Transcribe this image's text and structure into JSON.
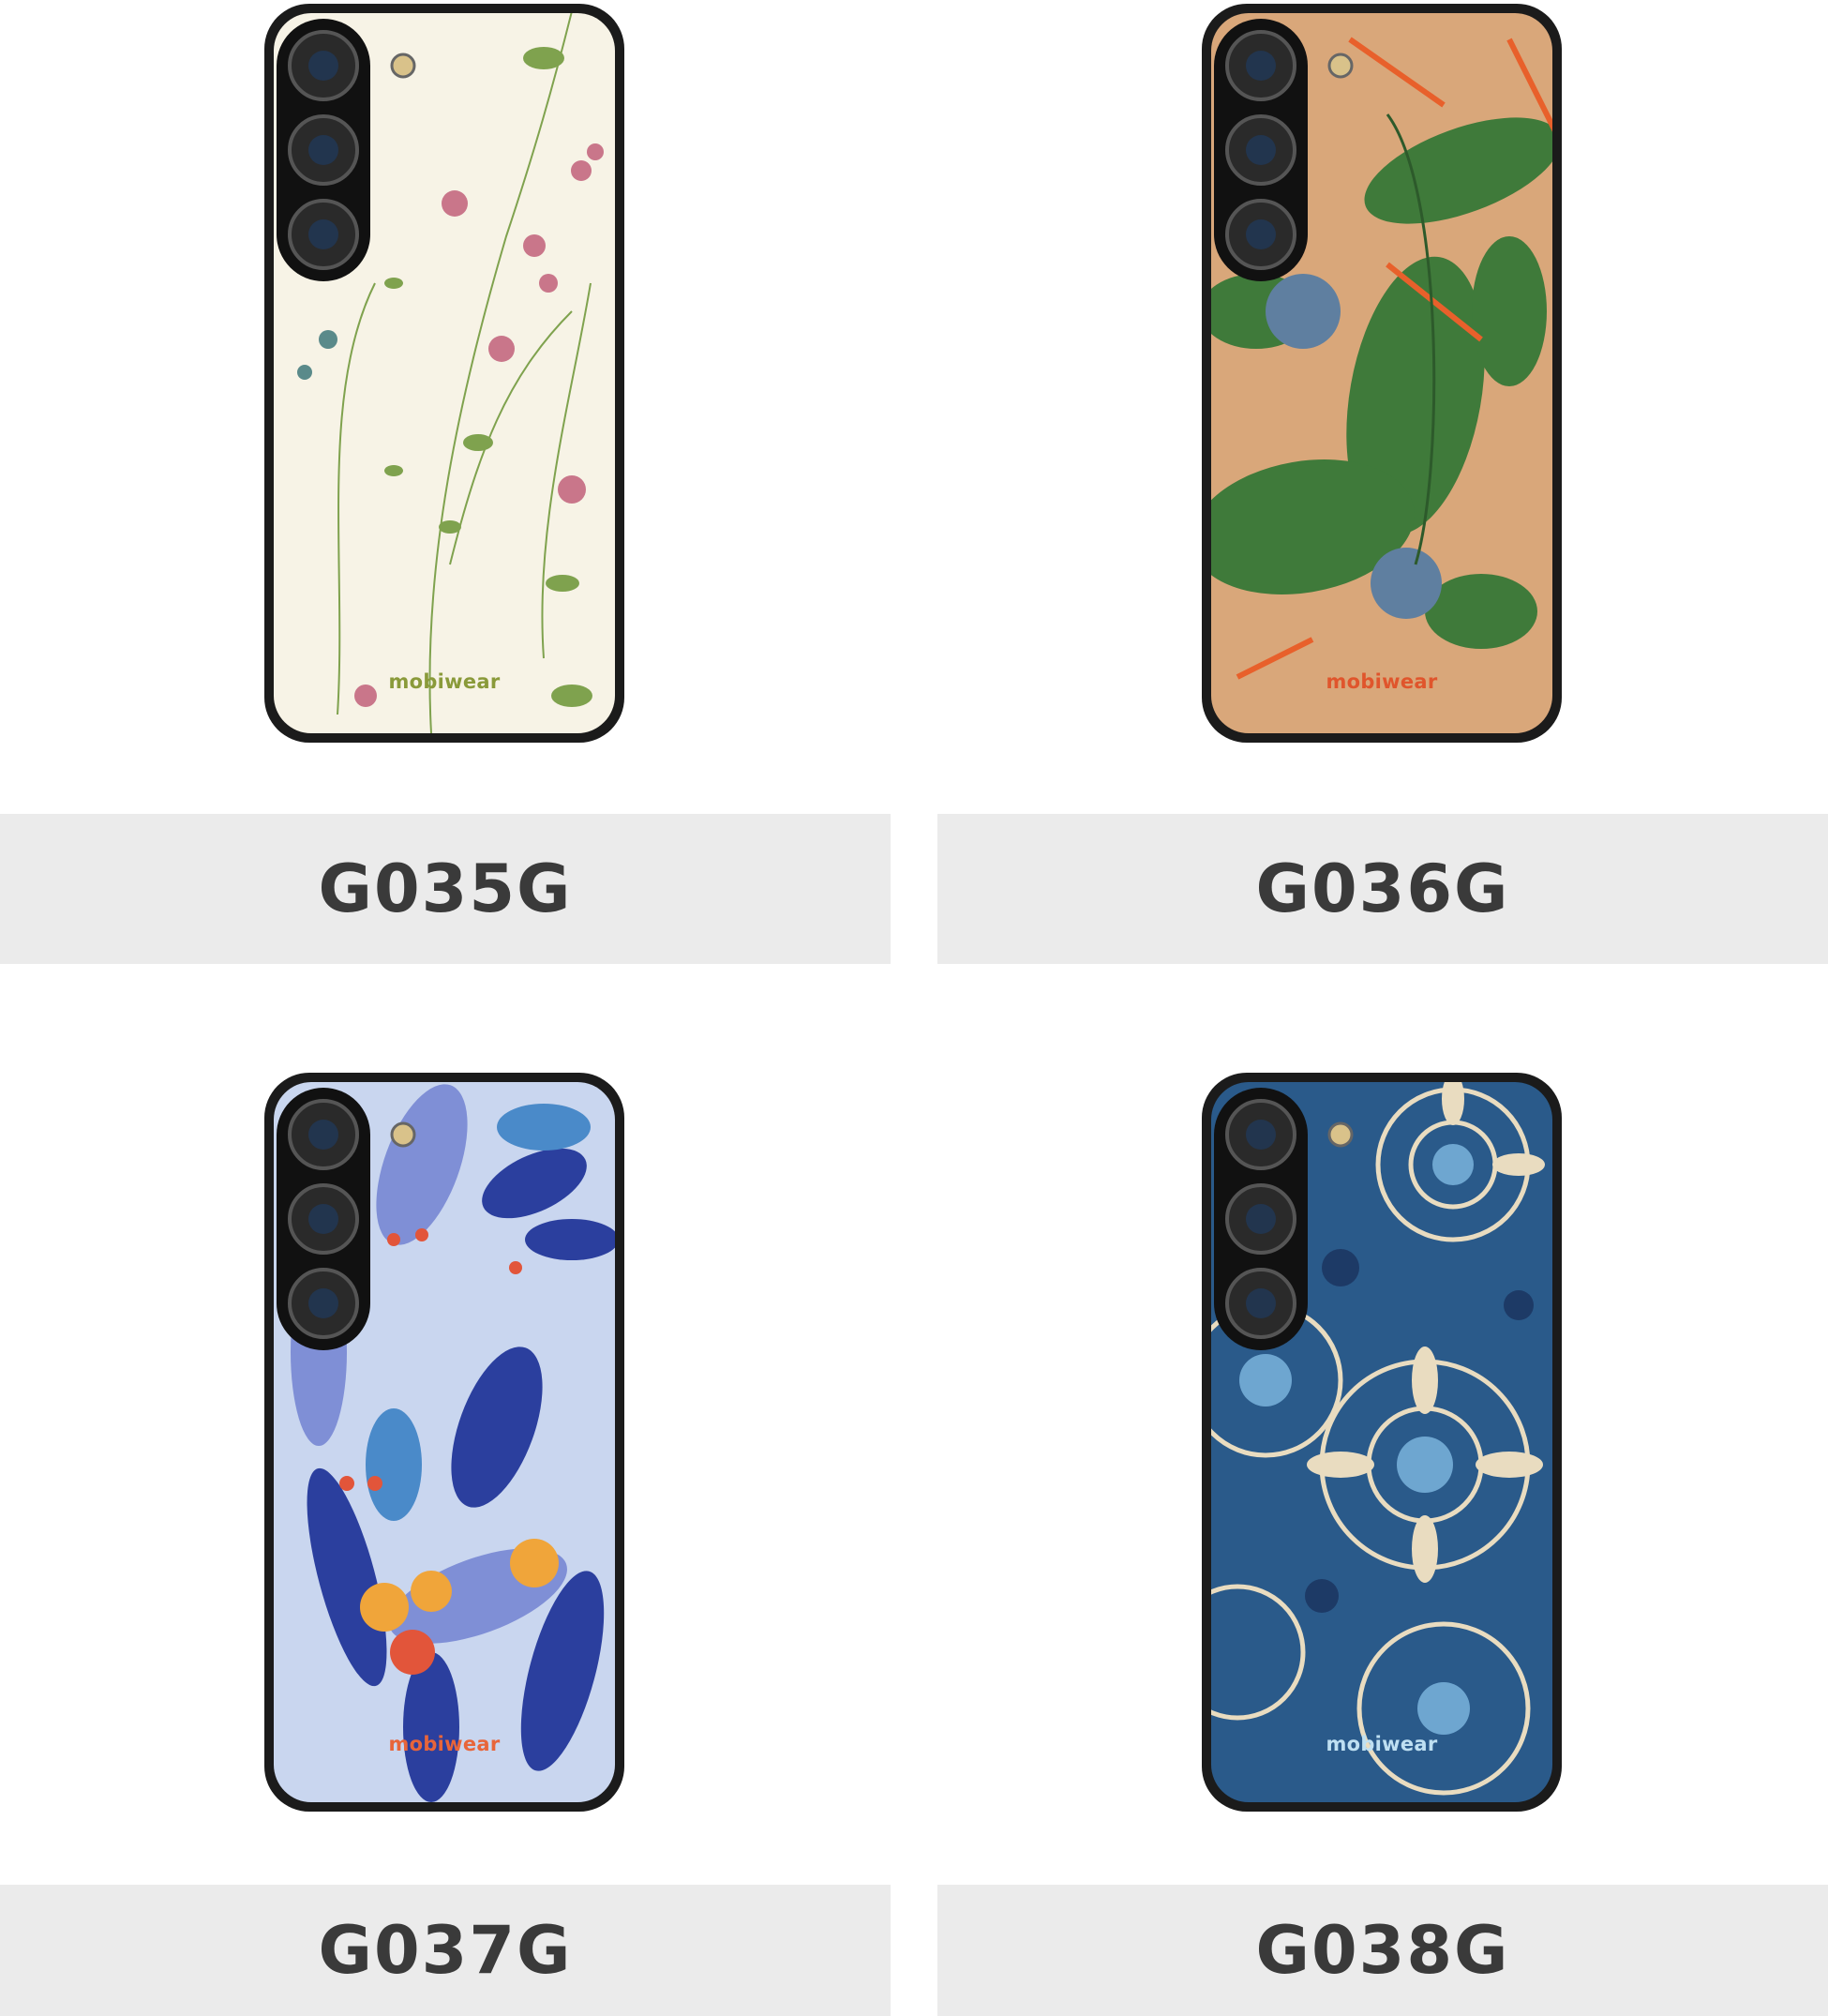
{
  "products": [
    {
      "code": "G035G",
      "brand": "mobiwear",
      "brand_color": "#8a9a3a",
      "pattern_icon": "wildflowers-pattern-icon",
      "palette": {
        "bg": "#f7f3e6",
        "accent1": "#c9768a",
        "accent2": "#7fa24e",
        "accent3": "#5a8a8a"
      }
    },
    {
      "code": "G036G",
      "brand": "mobiwear",
      "brand_color": "#e0552c",
      "pattern_icon": "tropical-leaves-pattern-icon",
      "palette": {
        "bg": "#d9a77a",
        "accent1": "#3f7a3a",
        "accent2": "#e8602b",
        "accent3": "#5f7fa0"
      }
    },
    {
      "code": "G037G",
      "brand": "mobiwear",
      "brand_color": "#e8653a",
      "pattern_icon": "blue-jungle-pattern-icon",
      "palette": {
        "bg": "#c9d6ef",
        "accent1": "#2b3f9e",
        "accent2": "#f0a53a",
        "accent3": "#e2553a"
      }
    },
    {
      "code": "G038G",
      "brand": "mobiwear",
      "brand_color": "#bfe0f2",
      "pattern_icon": "mandala-pattern-icon",
      "palette": {
        "bg": "#2a5a8a",
        "accent1": "#e9dcc0",
        "accent2": "#6ea6d0",
        "accent3": "#1d3a66"
      }
    }
  ]
}
